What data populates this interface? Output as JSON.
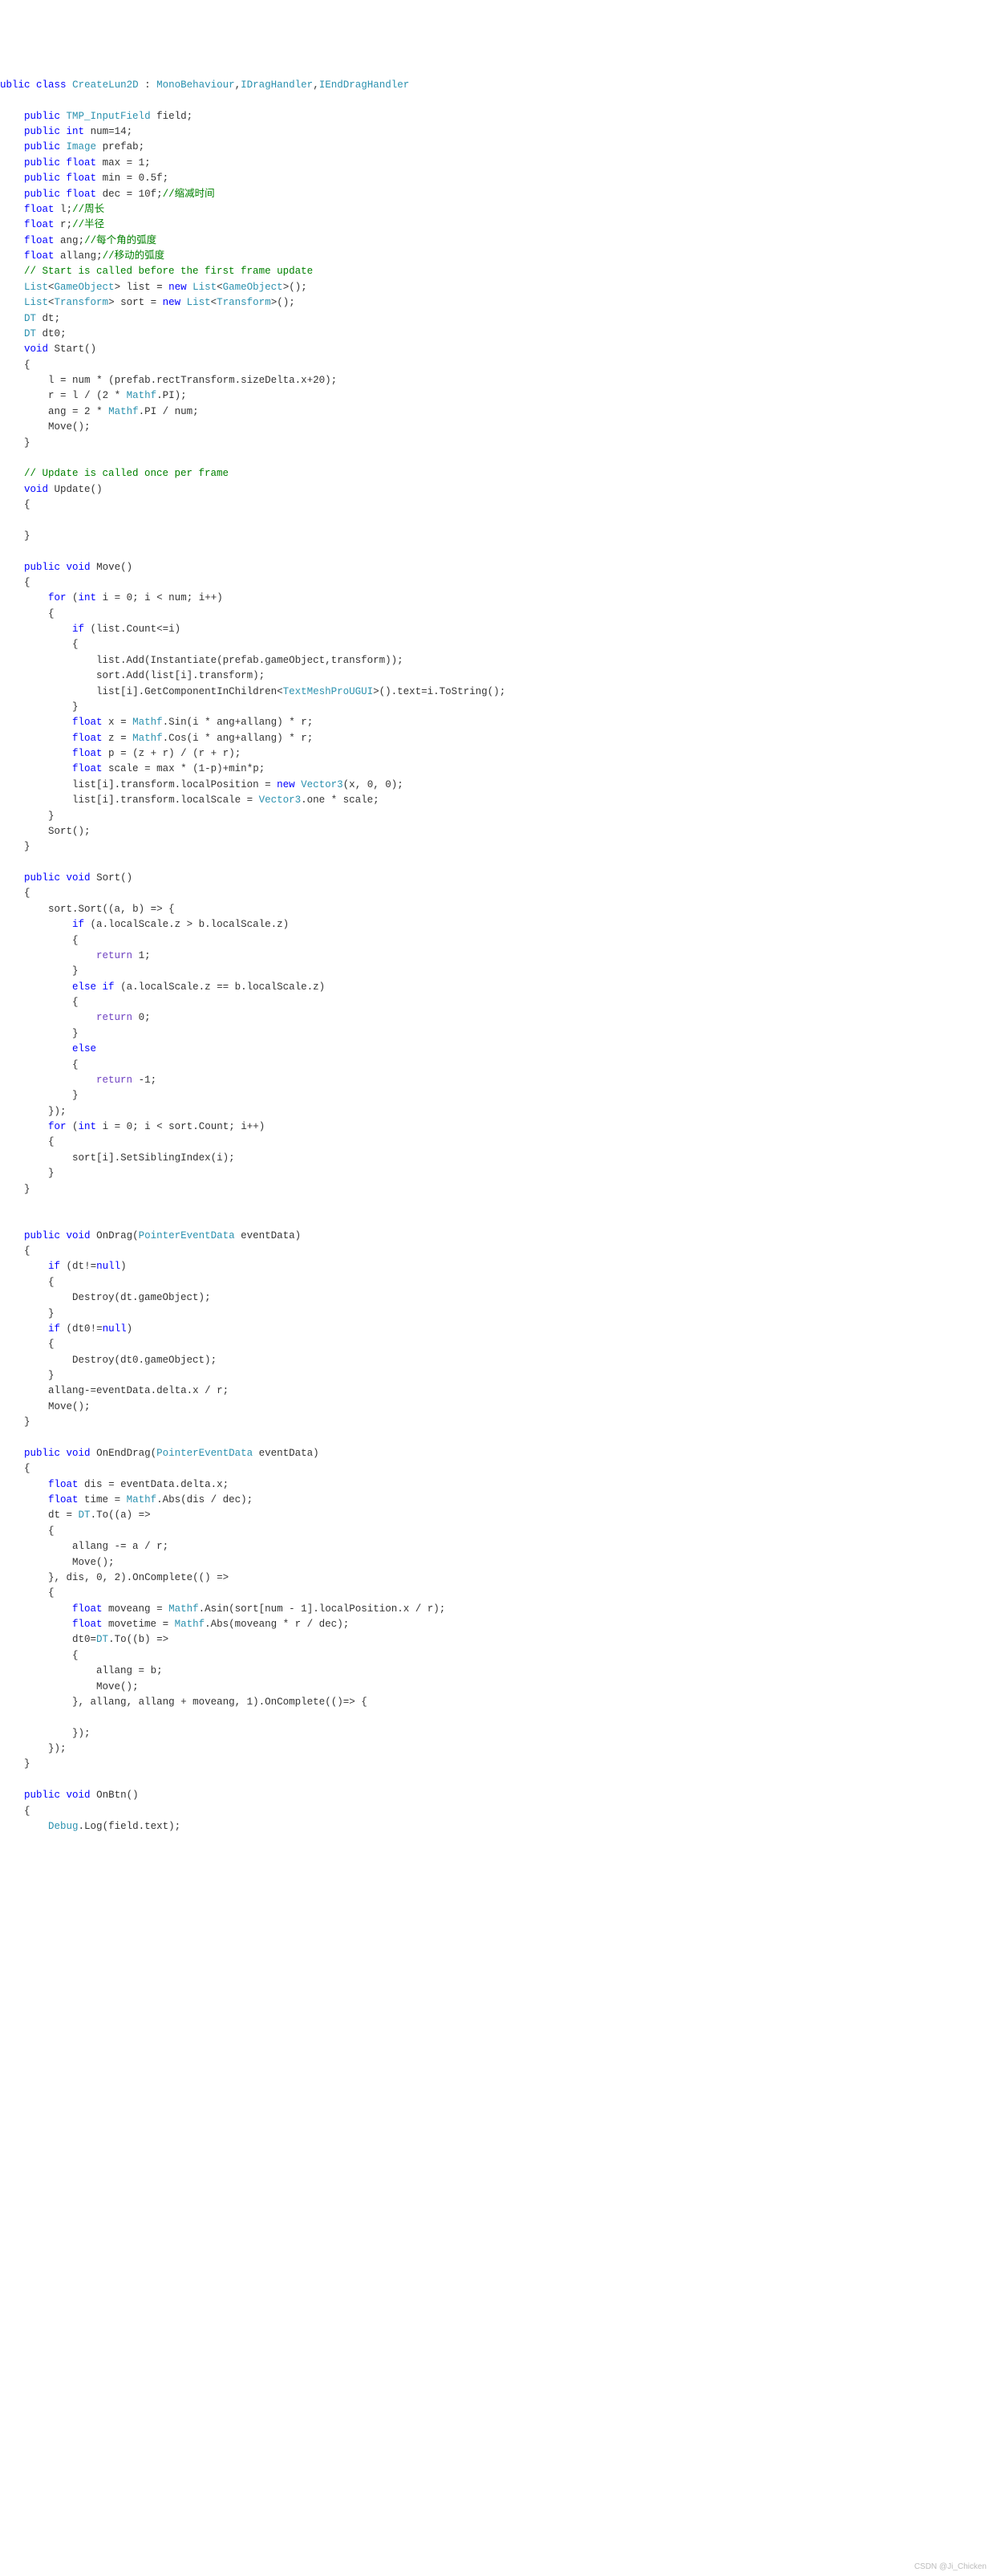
{
  "watermark": "CSDN @Ji_Chicken",
  "t": {
    "class_decl_1": "ublic",
    "class_decl_2": "class",
    "class_name": "CreateLun2D",
    "colon": ":",
    "mono": "MonoBehaviour",
    "idrag": "IDragHandler",
    "ienddrag": "IEndDragHandler",
    "comma": ",",
    "public": "public",
    "int": "int",
    "float": "float",
    "void": "void",
    "new": "new",
    "if": "if",
    "else": "else",
    "for": "for",
    "return": "return",
    "null": "null",
    "one": "one",
    "TMP_InputField": "TMP_InputField",
    "Image": "Image",
    "List": "List",
    "GameObject": "GameObject",
    "Transform": "Transform",
    "DT": "DT",
    "Mathf": "Mathf",
    "Vector3": "Vector3",
    "TextMeshProUGUI": "TextMeshProUGUI",
    "PointerEventData": "PointerEventData",
    "Debug": "Debug",
    "field": "field",
    "num_var": "num",
    "prefab": "prefab",
    "max": "max",
    "min": "min",
    "dec": "dec",
    "l_var": "l",
    "r_var": "r",
    "ang": "ang",
    "allang": "allang",
    "list": "list",
    "sort": "sort",
    "dt": "dt",
    "dt0": "dt0",
    "i": "i",
    "x": "x",
    "z": "z",
    "p": "p",
    "scale": "scale",
    "a": "a",
    "b": "b",
    "dis": "dis",
    "time": "time",
    "moveang": "moveang",
    "movetime": "movetime",
    "eventData": "eventData",
    "Start": "Start",
    "Update": "Update",
    "Move": "Move",
    "Sort": "Sort",
    "OnDrag": "OnDrag",
    "OnEndDrag": "OnEndDrag",
    "OnBtn": "OnBtn",
    "To": "To",
    "OnComplete": "OnComplete",
    "Log": "Log",
    "eq": " = ",
    "semi": ";",
    "lbrace": "{",
    "rbrace": "}",
    "lparen": "(",
    "rparen": ")",
    "langle": "<",
    "rangle": ">",
    "dot": ".",
    "plus": "+",
    "minus": "-",
    "star": "*",
    "slash": "/",
    "n14": "14",
    "n1": "1",
    "n05f": "0.5f",
    "n10f": "10f",
    "n20": "20",
    "n2": "2",
    "n0": "0",
    "nm1": "-1",
    "cmt_dec": "//缩减时间",
    "cmt_l": "//周长",
    "cmt_r": "//半径",
    "cmt_ang": "//每个角的弧度",
    "cmt_allang": "//移动的弧度",
    "cmt_start": "// Start is called before the first frame update",
    "cmt_update": "// Update is called once per frame",
    "line_field": "public TMP_InputField field;",
    "line_num": "public int num=14;",
    "line_prefab": "public Image prefab;",
    "line_max": "public float max = 1;",
    "line_min": "public float min = 0.5f;",
    "line_dec_a": "public float dec = 10f;",
    "line_l": "float l;",
    "line_r": "float r;",
    "line_ang": "float ang;",
    "line_allang": "float allang;",
    "line_list": "List<GameObject> list = new List<GameObject>();",
    "line_sort": "List<Transform> sort = new List<Transform>();",
    "line_dt": "DT dt;",
    "line_dt0": "DT dt0;",
    "start_l1": "l = num * (prefab.rectTransform.sizeDelta.x+20);",
    "start_l2": "r = l / (2 * Mathf.PI);",
    "start_l3": "ang = 2 * Mathf.PI / num;",
    "start_l4": "Move();",
    "move_for": "for (int i = 0; i < num; i++)",
    "move_if": "if (list.Count<=i)",
    "move_add1": "list.Add(Instantiate(prefab.gameObject,transform));",
    "move_add2": "sort.Add(list[i].transform);",
    "move_add3": "list[i].GetComponentInChildren<TextMeshProUGUI>().text=i.ToString();",
    "move_x": "float x = Mathf.Sin(i * ang+allang) * r;",
    "move_z": "float z = Mathf.Cos(i * ang+allang) * r;",
    "move_p": "float p = (z + r) / (r + r);",
    "move_scale": "float scale = max * (1-p)+min*p;",
    "move_pos": "list[i].transform.localPosition = new Vector3(x, 0, 0);",
    "move_scl": "list[i].transform.localScale = Vector3.one * scale;",
    "move_sort": "Sort();",
    "sort_head": "sort.Sort((a, b) => {",
    "sort_if": "if (a.localScale.z > b.localScale.z)",
    "sort_ret1": "return 1;",
    "sort_elif": "else if (a.localScale.z == b.localScale.z)",
    "sort_ret0": "return 0;",
    "sort_else": "else",
    "sort_retm1": "return -1;",
    "sort_close": "});",
    "sort_for": "for (int i = 0; i < sort.Count; i++)",
    "sort_set": "sort[i].SetSiblingIndex(i);",
    "ondrag_sig": "public void OnDrag(PointerEventData eventData)",
    "ondrag_if1": "if (dt!=null)",
    "ondrag_d1": "Destroy(dt.gameObject);",
    "ondrag_if2": "if (dt0!=null)",
    "ondrag_d2": "Destroy(dt0.gameObject);",
    "ondrag_a": "allang-=eventData.delta.x / r;",
    "ondrag_m": "Move();",
    "onend_sig": "public void OnEndDrag(PointerEventData eventData)",
    "onend_dis": "float dis = eventData.delta.x;",
    "onend_time": "float time = Mathf.Abs(dis / dec);",
    "onend_dt": "dt = DT.To((a) =>",
    "onend_a1": "allang -= a / r;",
    "onend_a2": "Move();",
    "onend_tail": "}, dis, 0, 2).OnComplete(() =>",
    "onend_mva": "float moveang = Mathf.Asin(sort[num - 1].localPosition.x / r);",
    "onend_mvt": "float movetime = Mathf.Abs(moveang * r / dec);",
    "onend_dt0": "dt0=DT.To((b) =>",
    "onend_b1": "allang = b;",
    "onend_b2": "Move();",
    "onend_btail": "}, allang, allang + moveang, 1).OnComplete(()=> {",
    "onend_close1": "});",
    "onend_close2": "});",
    "onbtn_sig": "public void OnBtn()",
    "onbtn_log": "Debug.Log(field.text);"
  }
}
